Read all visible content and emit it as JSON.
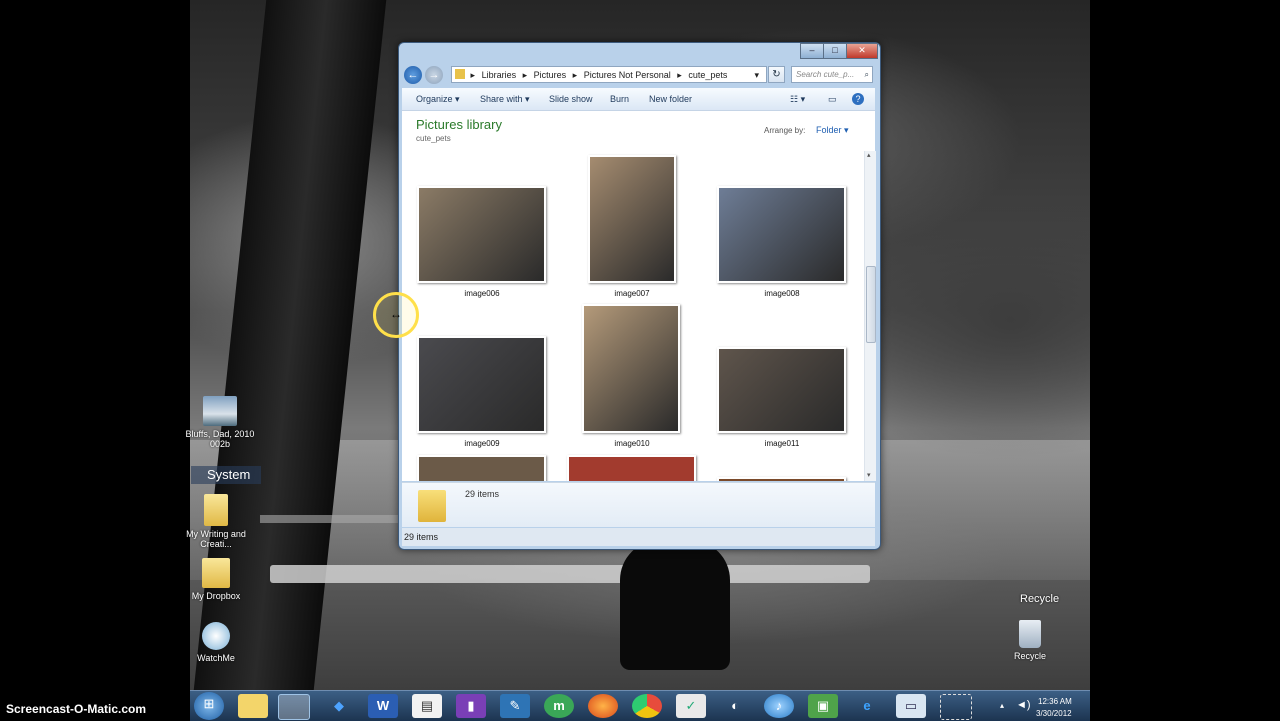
{
  "desktop": {
    "icons": [
      {
        "label": "Bluffs, Dad, 2010 002b"
      },
      {
        "label": "My Writing and Creati..."
      },
      {
        "label": "My Dropbox"
      },
      {
        "label": "WatchMe"
      },
      {
        "label": "Recycle"
      }
    ],
    "gadget_title": "System",
    "recycle_heading": "Recycle"
  },
  "window": {
    "address": [
      "Libraries",
      "Pictures",
      "Pictures Not Personal",
      "cute_pets"
    ],
    "search_placeholder": "Search cute_p...",
    "toolbar": {
      "organize": "Organize",
      "share_with": "Share with",
      "slide_show": "Slide show",
      "burn": "Burn",
      "new_folder": "New folder"
    },
    "library_title": "Pictures library",
    "library_subtitle": "cute_pets",
    "arrange_by_label": "Arrange by:",
    "arrange_by_value": "Folder",
    "thumbnails": [
      {
        "name": "image006",
        "color": "#8b7b66"
      },
      {
        "name": "image007",
        "color": "#a58c70"
      },
      {
        "name": "image008",
        "color": "#6e7d96"
      },
      {
        "name": "image009",
        "color": "#4a4a4e"
      },
      {
        "name": "image010",
        "color": "#b49a7a"
      },
      {
        "name": "image011",
        "color": "#5f554c"
      }
    ],
    "details_count": "29 items",
    "status_text": "29 items"
  },
  "taskbar": {
    "time": "12:36 AM",
    "date": "3/30/2012"
  },
  "watermark": "Screencast-O-Matic.com"
}
